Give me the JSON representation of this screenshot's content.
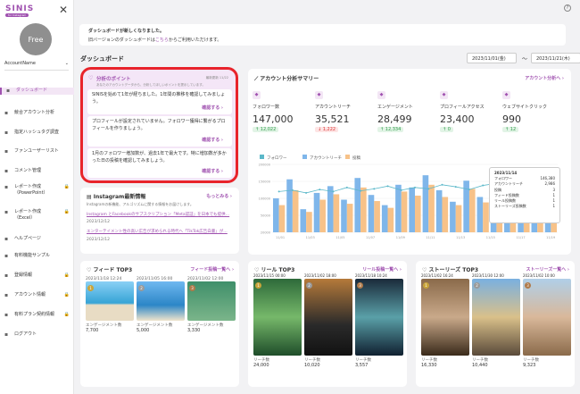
{
  "sidebar": {
    "logo": "SINIS",
    "logo_sub": "for Instagram",
    "plan": "Free",
    "account": "AccountName",
    "items": [
      {
        "label": "ダッシュボード",
        "icon": "grid-icon",
        "active": true
      },
      {
        "label": "競合アカウント分析",
        "icon": "compare-icon"
      },
      {
        "label": "指定ハッシュタグ調査",
        "icon": "hashtag-icon"
      },
      {
        "label": "ファンユーザーリスト",
        "icon": "users-icon"
      },
      {
        "label": "コメント管理",
        "icon": "comment-icon"
      },
      {
        "label": "レポート作成",
        "label2": "（PowerPoint）",
        "icon": "report-icon",
        "lock": true
      },
      {
        "label": "レポート作成",
        "label2": "（Excel）",
        "icon": "report-icon",
        "lock": true
      },
      {
        "label": "ヘルプページ",
        "icon": "help-icon"
      },
      {
        "label": "有料機能サンプル",
        "icon": "sample-icon"
      },
      {
        "label": "登録情報",
        "icon": "info-icon",
        "lock": true
      },
      {
        "label": "アカウント情報",
        "icon": "account-icon",
        "lock": true
      },
      {
        "label": "有料プラン契約情報",
        "icon": "plan-icon",
        "lock": true
      },
      {
        "label": "ログアウト",
        "icon": "logout-icon"
      }
    ]
  },
  "banner": {
    "title": "ダッシュボードが新しくなりました。",
    "pre": "旧バージョンのダッシュボードは",
    "link": "こちら",
    "post": "からご利用いただけます。"
  },
  "dashboard_title": "ダッシュボード",
  "dates": {
    "start": "2023/11/01(金)",
    "sep": "〜",
    "end": "2023/11/21(木)"
  },
  "points": {
    "title": "分析のポイント",
    "subtitle": "あなたのアカウントデータから、分析してほしいポイントを提示しています。",
    "updated": "最新更新 11/22",
    "items": [
      {
        "text": "SINISを始めて1年が経ちました。1年間の推移を確認してみましょう。",
        "cta": "確認する ›"
      },
      {
        "text": "プロフィールが設定されていません。フォロワー獲得に繋がるプロフィールを作りましょう。",
        "cta": "確認する ›"
      },
      {
        "text": "1月のフォロワー増加数が、過去1年で最大です。特に増加数が多かった日の投稿を確認してみましょう。",
        "cta": "確認する ›"
      }
    ]
  },
  "news": {
    "title": "Instagram最新情報",
    "more": "もっとみる ›",
    "desc": "Instagramの新機能、アルゴリズムに関する情報をお届けします。",
    "items": [
      {
        "title": "Instagram とFacebookのサブスクリプション「Meta認証」を日本でも提供…",
        "date": "2023/12/12"
      },
      {
        "title": "エンターテイメント性の高い広告が求められる時代へ「TikTok広告白書」が…",
        "date": "2023/12/12"
      }
    ]
  },
  "summary": {
    "title": "アカウント分析サマリー",
    "link": "アカウント分析へ ›",
    "kpis": [
      {
        "label": "フォロワー数",
        "value": "147,000",
        "change": "↑ 12,022",
        "dir": "up",
        "icon": "person-icon"
      },
      {
        "label": "アカウントリーチ",
        "value": "35,521",
        "change": "↓ 1,222",
        "dir": "down",
        "icon": "reach-icon"
      },
      {
        "label": "エンゲージメント",
        "value": "28,499",
        "change": "↑ 12,334",
        "dir": "up",
        "icon": "heart-icon"
      },
      {
        "label": "プロフィールアクセス",
        "value": "23,400",
        "change": "↑ 0",
        "dir": "up",
        "icon": "profile-icon"
      },
      {
        "label": "ウェブサイトクリック",
        "value": "990",
        "change": "↑ 12",
        "dir": "up",
        "icon": "link-icon"
      }
    ],
    "legend": [
      "フォロワー",
      "アカウントリーチ",
      "投稿"
    ],
    "tooltip": {
      "date": "2023/11/14",
      "rows": [
        [
          "フォロワー",
          "146,380"
        ],
        [
          "アカウントリーチ",
          "2,986"
        ],
        [
          "投稿",
          "3"
        ],
        [
          "フィード投稿数",
          "1"
        ],
        [
          "リール投稿数",
          "1"
        ],
        [
          "ストーリーズ投稿数",
          "1"
        ]
      ]
    }
  },
  "chart_data": {
    "type": "bar",
    "series": [
      {
        "name": "フォロワー",
        "type": "line",
        "values": [
          60,
          62,
          58,
          63,
          60,
          66,
          61,
          64,
          68,
          62,
          66,
          64,
          70,
          67,
          63,
          69,
          72,
          68,
          74,
          71,
          76
        ]
      },
      {
        "name": "アカウントリーチ",
        "values": [
          50,
          78,
          34,
          58,
          68,
          48,
          80,
          55,
          40,
          70,
          66,
          84,
          62,
          45,
          76,
          52,
          88,
          64,
          92,
          58,
          96
        ]
      },
      {
        "name": "投稿",
        "values": [
          40,
          62,
          30,
          48,
          56,
          42,
          66,
          46,
          36,
          60,
          54,
          70,
          52,
          40,
          64,
          44,
          74,
          54,
          78,
          50,
          82
        ]
      }
    ],
    "ytick": [
      "200000",
      "150000",
      "100000",
      "50000",
      "20000"
    ],
    "xtick": [
      "11/01",
      "11/03",
      "11/05",
      "11/07",
      "11/09",
      "11/11",
      "11/13",
      "11/15",
      "11/17",
      "11/19"
    ],
    "colors": [
      "#5bb8c9",
      "#7fb6ea",
      "#f7c289"
    ]
  },
  "feed": {
    "title": "フィード TOP3",
    "link": "フィード投稿一覧へ ›",
    "posts": [
      {
        "date": "2023/11/18 12:24",
        "label": "エンゲージメント数",
        "value": "7,700"
      },
      {
        "date": "2023/11/05 16:00",
        "label": "エンゲージメント数",
        "value": "5,000"
      },
      {
        "date": "2023/11/02 12:00",
        "label": "エンゲージメント数",
        "value": "3,330"
      }
    ]
  },
  "reel": {
    "title": "リール TOP3",
    "link": "リール投稿一覧へ ›",
    "posts": [
      {
        "date": "2023/11/15 00:00",
        "label": "リーチ数",
        "value": "24,000"
      },
      {
        "date": "2023/11/02 18:00",
        "label": "リーチ数",
        "value": "10,020"
      },
      {
        "date": "2023/11/18 10:24",
        "label": "リーチ数",
        "value": "3,557"
      }
    ]
  },
  "stories": {
    "title": "ストーリーズ TOP3",
    "link": "ストーリーズ一覧へ ›",
    "posts": [
      {
        "date": "2023/11/02 16:24",
        "label": "リーチ数",
        "value": "16,330"
      },
      {
        "date": "2023/11/30 12:00",
        "label": "リーチ数",
        "value": "10,440"
      },
      {
        "date": "2023/11/02 10:00",
        "label": "リーチ数",
        "value": "9,323"
      }
    ]
  }
}
